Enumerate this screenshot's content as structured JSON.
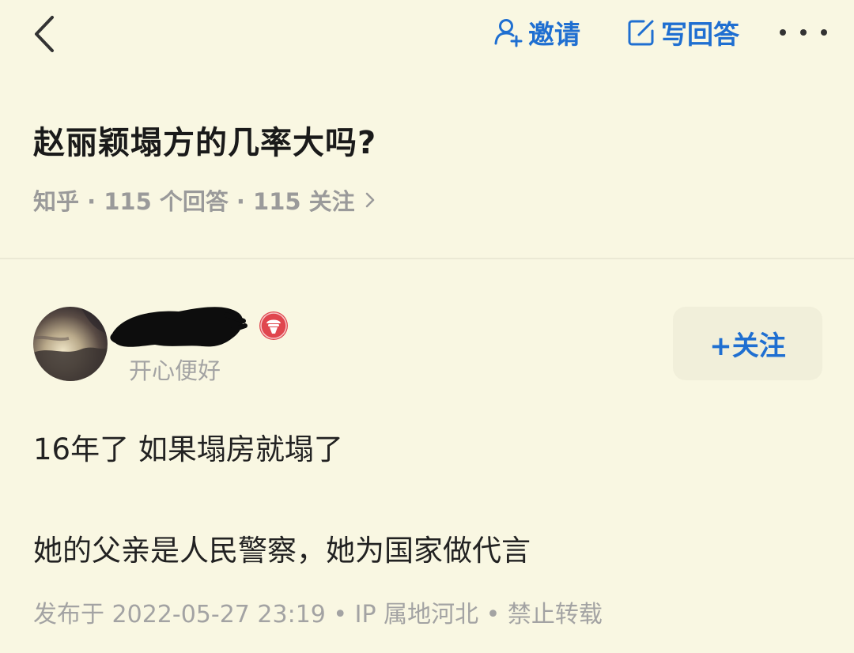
{
  "header": {
    "invite_label": "邀请",
    "write_answer_label": "写回答"
  },
  "question": {
    "title": "赵丽颖塌方的几率大吗?",
    "meta": "知乎 · 115 个回答 · 115 关注"
  },
  "answer": {
    "author_bio": "开心便好",
    "follow_label": "+关注",
    "paragraphs": [
      "16年了 如果塌房就塌了",
      "她的父亲是人民警察，她为国家做代言"
    ],
    "footer": "发布于 2022-05-27 23:19 • IP 属地河北 • 禁止转载"
  },
  "colors": {
    "background": "#f9f7e2",
    "accent": "#1f6fd1",
    "muted": "#a3a3a3",
    "badge": "#e0464e"
  }
}
